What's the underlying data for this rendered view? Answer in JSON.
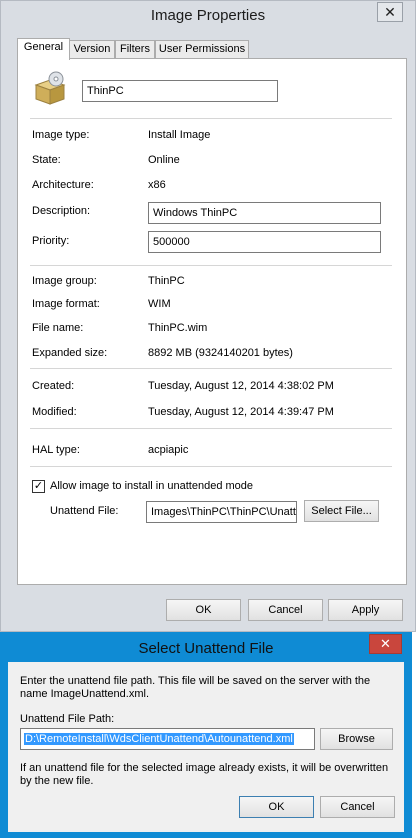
{
  "main_window": {
    "title": "Image Properties",
    "close_glyph": "✕",
    "tabs": [
      "General",
      "Version",
      "Filters",
      "User Permissions"
    ],
    "image_name": "ThinPC",
    "fields": {
      "image_type": {
        "label": "Image type:",
        "value": "Install Image"
      },
      "state": {
        "label": "State:",
        "value": "Online"
      },
      "architecture": {
        "label": "Architecture:",
        "value": "x86"
      },
      "description": {
        "label": "Description:",
        "value": "Windows ThinPC"
      },
      "priority": {
        "label": "Priority:",
        "value": "500000"
      },
      "image_group": {
        "label": "Image group:",
        "value": "ThinPC"
      },
      "image_format": {
        "label": "Image format:",
        "value": "WIM"
      },
      "file_name": {
        "label": "File name:",
        "value": "ThinPC.wim"
      },
      "expanded_size": {
        "label": "Expanded size:",
        "value": "8892 MB (9324140201 bytes)"
      },
      "created": {
        "label": "Created:",
        "value": "Tuesday, August 12, 2014 4:38:02 PM"
      },
      "modified": {
        "label": "Modified:",
        "value": "Tuesday, August 12, 2014 4:39:47 PM"
      },
      "hal_type": {
        "label": "HAL type:",
        "value": "acpiapic"
      }
    },
    "unattended_checkbox": {
      "label": "Allow image to install in unattended mode",
      "checked": true
    },
    "unattend_file": {
      "label": "Unattend File:",
      "value": "Images\\ThinPC\\ThinPC\\Unatt",
      "button": "Select File..."
    },
    "buttons": {
      "ok": "OK",
      "cancel": "Cancel",
      "apply": "Apply"
    },
    "icon": "install-image-icon"
  },
  "dialog": {
    "title": "Select Unattend File",
    "close_glyph": "✕",
    "instructions": "Enter the unattend file path. This file will be saved on the server with the name ImageUnattend.xml.",
    "path_label": "Unattend File Path:",
    "path_value": "D:\\RemoteInstall\\WdsClientUnattend\\Autounattend.xml",
    "browse_button": "Browse",
    "overwrite_note": "If an unattend file for the selected image already exists, it will be overwritten by the new file.",
    "buttons": {
      "ok": "OK",
      "cancel": "Cancel"
    }
  },
  "colors": {
    "dialog_frame": "#0f8bd4",
    "close_red": "#c9463d",
    "selection": "#3399ff"
  }
}
